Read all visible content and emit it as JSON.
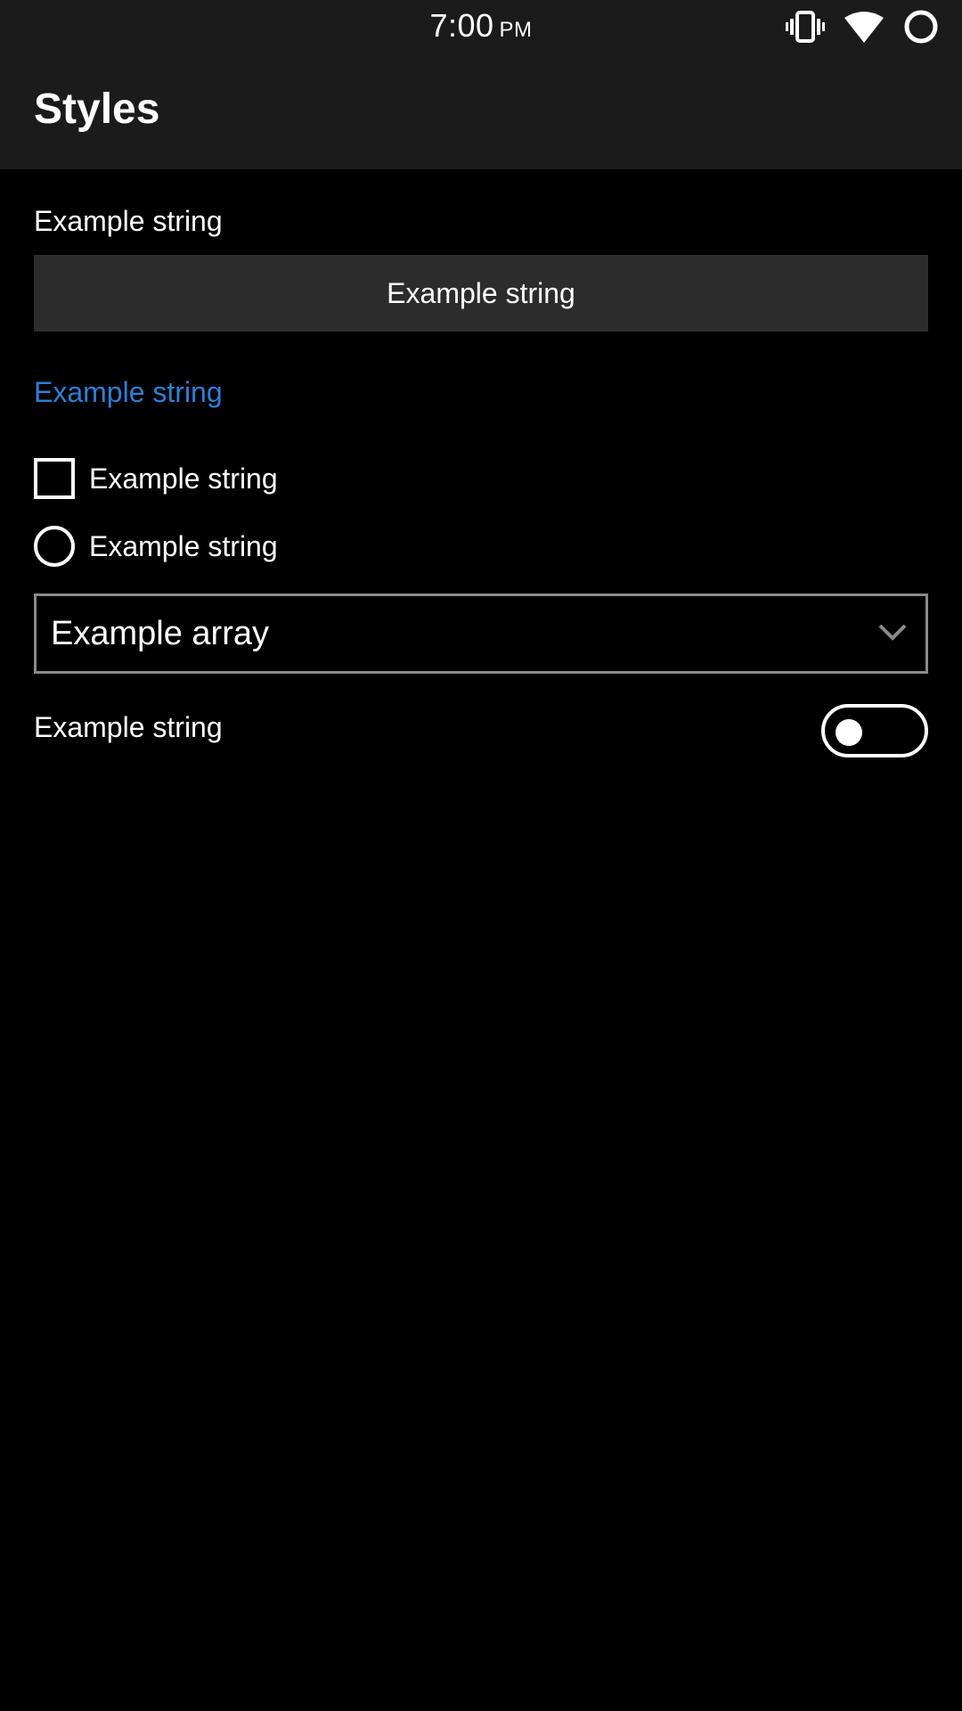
{
  "status_bar": {
    "time": "7:00",
    "ampm": "PM",
    "icons": [
      "vibrate-icon",
      "wifi-icon",
      "battery-circle-icon"
    ]
  },
  "app_bar": {
    "title": "Styles"
  },
  "content": {
    "label": "Example string",
    "button_label": "Example string",
    "link_label": "Example string",
    "checkbox_label": "Example string",
    "radio_label": "Example string",
    "select_value": "Example array",
    "switch_label": "Example string",
    "checkbox_checked": false,
    "radio_selected": false,
    "switch_on": false
  },
  "colors": {
    "background": "#000000",
    "bar": "#1b1b1b",
    "button": "#2c2c2c",
    "link": "#2f7fd6",
    "select_border": "#8a8a8a"
  }
}
